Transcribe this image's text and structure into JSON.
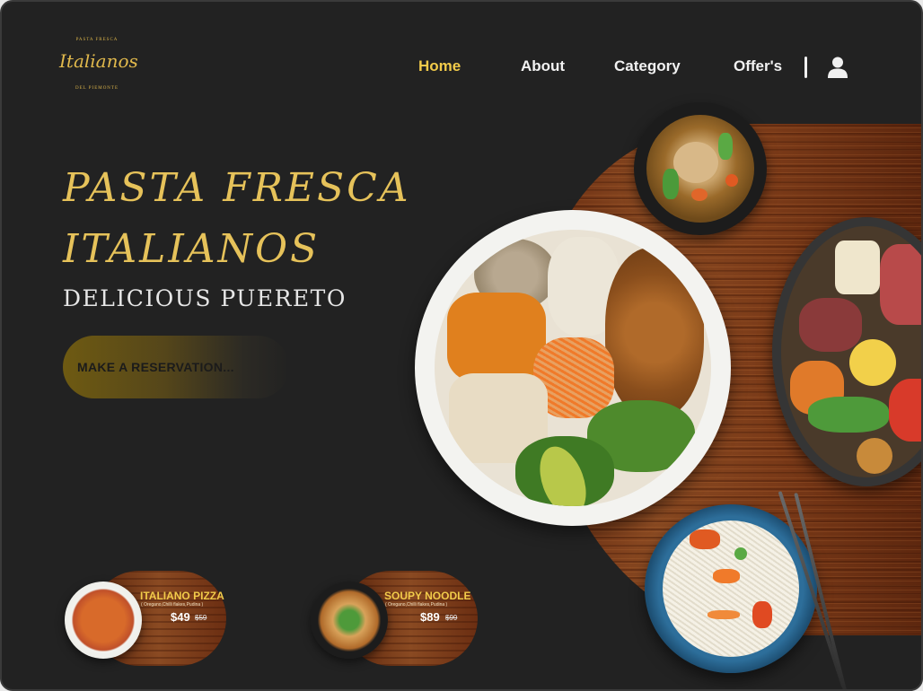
{
  "logo": {
    "top_text": "PASTA FRESCA",
    "main_text": "Italianos",
    "bottom_text": "DEL PIEMONTE",
    "accent": "#e1b94c"
  },
  "nav": {
    "items": [
      {
        "label": "Home",
        "active": true
      },
      {
        "label": "About",
        "active": false
      },
      {
        "label": "Category",
        "active": false
      },
      {
        "label": "Offer's",
        "active": false
      }
    ],
    "user_icon": "user-icon"
  },
  "hero": {
    "title_line1": "PASTA FRESCA",
    "title_line2": "ITALIANOS",
    "subtitle": "DELICIOUS PUERETO",
    "cta_label": "MAKE A RESERVATION..."
  },
  "products": [
    {
      "name": "ITALIANO PIZZA",
      "note": "( Oregano,Chilli flakes,Pudina )",
      "price": "$49",
      "old_price": "$59"
    },
    {
      "name": "SOUPY NOODLE",
      "note": "( Oregano,Chilli flakes,Pudina )",
      "price": "$89",
      "old_price": "$99"
    }
  ],
  "colors": {
    "background": "#222222",
    "gold": "#f2cb4a",
    "text": "#f2f2f2"
  }
}
